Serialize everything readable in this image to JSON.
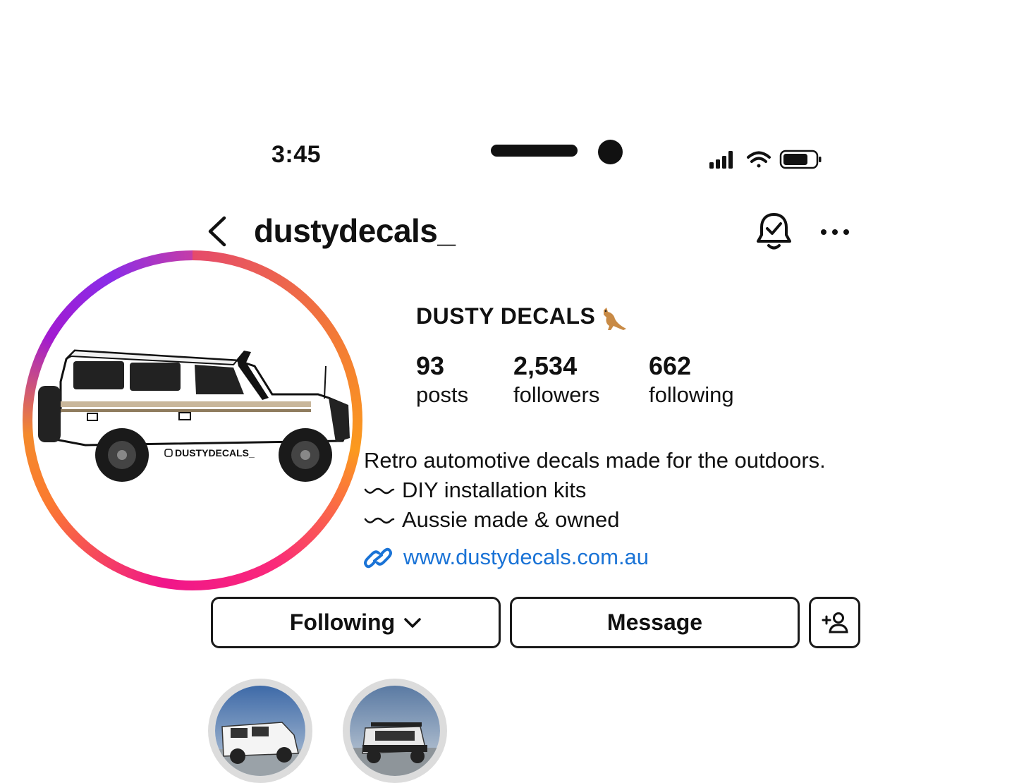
{
  "status_bar": {
    "time": "3:45",
    "icons": [
      "signal-icon",
      "wifi-icon",
      "battery-icon"
    ]
  },
  "header": {
    "handle": "dustydecals_",
    "back_icon": "chevron-left-icon",
    "bell_icon": "bell-check-icon",
    "more_icon": "more-horizontal-icon"
  },
  "profile": {
    "display_name": "DUSTY DECALS",
    "name_emoji": "kangaroo-icon",
    "avatar_watermark": "DUSTYDECALS_",
    "stats": [
      {
        "value": "93",
        "label": "posts"
      },
      {
        "value": "2,534",
        "label": "followers"
      },
      {
        "value": "662",
        "label": "following"
      }
    ],
    "bio": [
      "Retro automotive decals made for the outdoors.",
      "DIY installation kits",
      "Aussie made & owned"
    ],
    "website": "www.dustydecals.com.au"
  },
  "actions": {
    "following_label": "Following",
    "message_label": "Message",
    "add_icon": "add-person-icon"
  },
  "colors": {
    "link": "#1a73d6",
    "ring_purple": "#8a2ce8",
    "ring_orange": "#fb9a1e",
    "ring_pink": "#f0158a"
  }
}
